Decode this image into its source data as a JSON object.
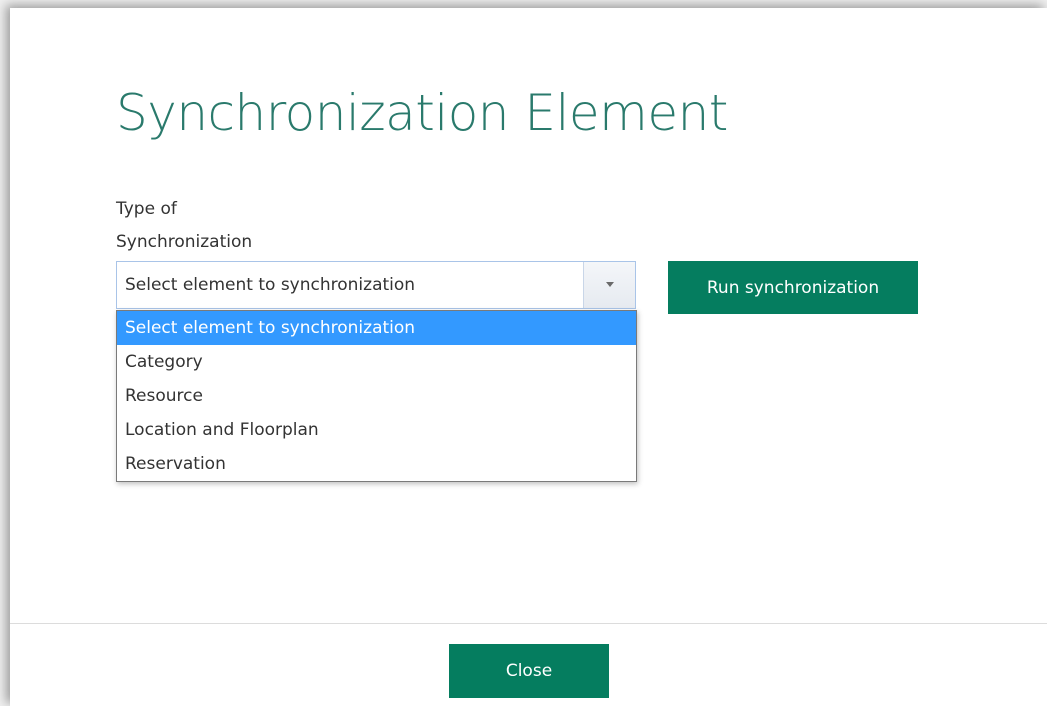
{
  "dialog": {
    "title": "Synchronization Element",
    "field_label_line1": "Type of",
    "field_label_line2": "Synchronization",
    "select": {
      "value": "Select element to synchronization",
      "options": [
        "Select element to synchronization",
        "Category",
        "Resource",
        "Location and Floorplan",
        "Reservation"
      ],
      "selected_index": 0
    },
    "run_button_label": "Run synchronization",
    "close_button_label": "Close"
  },
  "colors": {
    "title": "#2a7a6c",
    "button_bg": "#057d5f",
    "option_highlight": "#3399ff"
  },
  "icons": {
    "select_arrow": "chevron-down-icon"
  }
}
